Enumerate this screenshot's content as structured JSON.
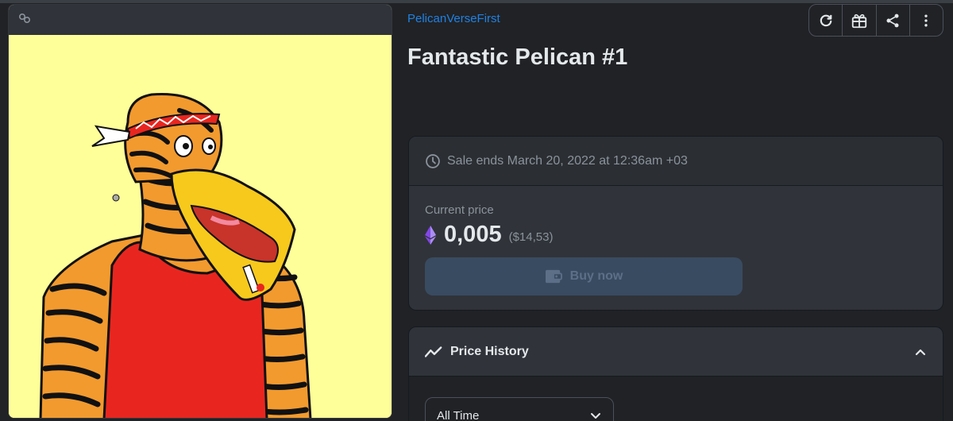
{
  "collection": {
    "name": "PelicanVerseFirst"
  },
  "asset": {
    "title": "Fantastic Pelican #1"
  },
  "sale": {
    "ends_text": "Sale ends March 20, 2022 at 12:36am +03",
    "current_price_label": "Current price",
    "price": "0,005",
    "price_usd": "($14,53)",
    "buy_label": "Buy now"
  },
  "history": {
    "title": "Price History",
    "time_filter": "All Time"
  },
  "icons": {
    "refresh": "refresh-icon",
    "gift": "gift-icon",
    "share": "share-icon",
    "more": "more-vertical-icon",
    "clock": "clock-icon",
    "eth": "ethereum-icon",
    "wallet": "wallet-icon",
    "trend": "trending-icon",
    "chevron_up": "chevron-up-icon",
    "chevron_down": "chevron-down-icon",
    "chain": "polygon-chain-icon"
  },
  "colors": {
    "link": "#2081e2",
    "background": "#202225",
    "card": "#303339",
    "buy_button": "#394b61",
    "image_bg": "#ffff99"
  }
}
